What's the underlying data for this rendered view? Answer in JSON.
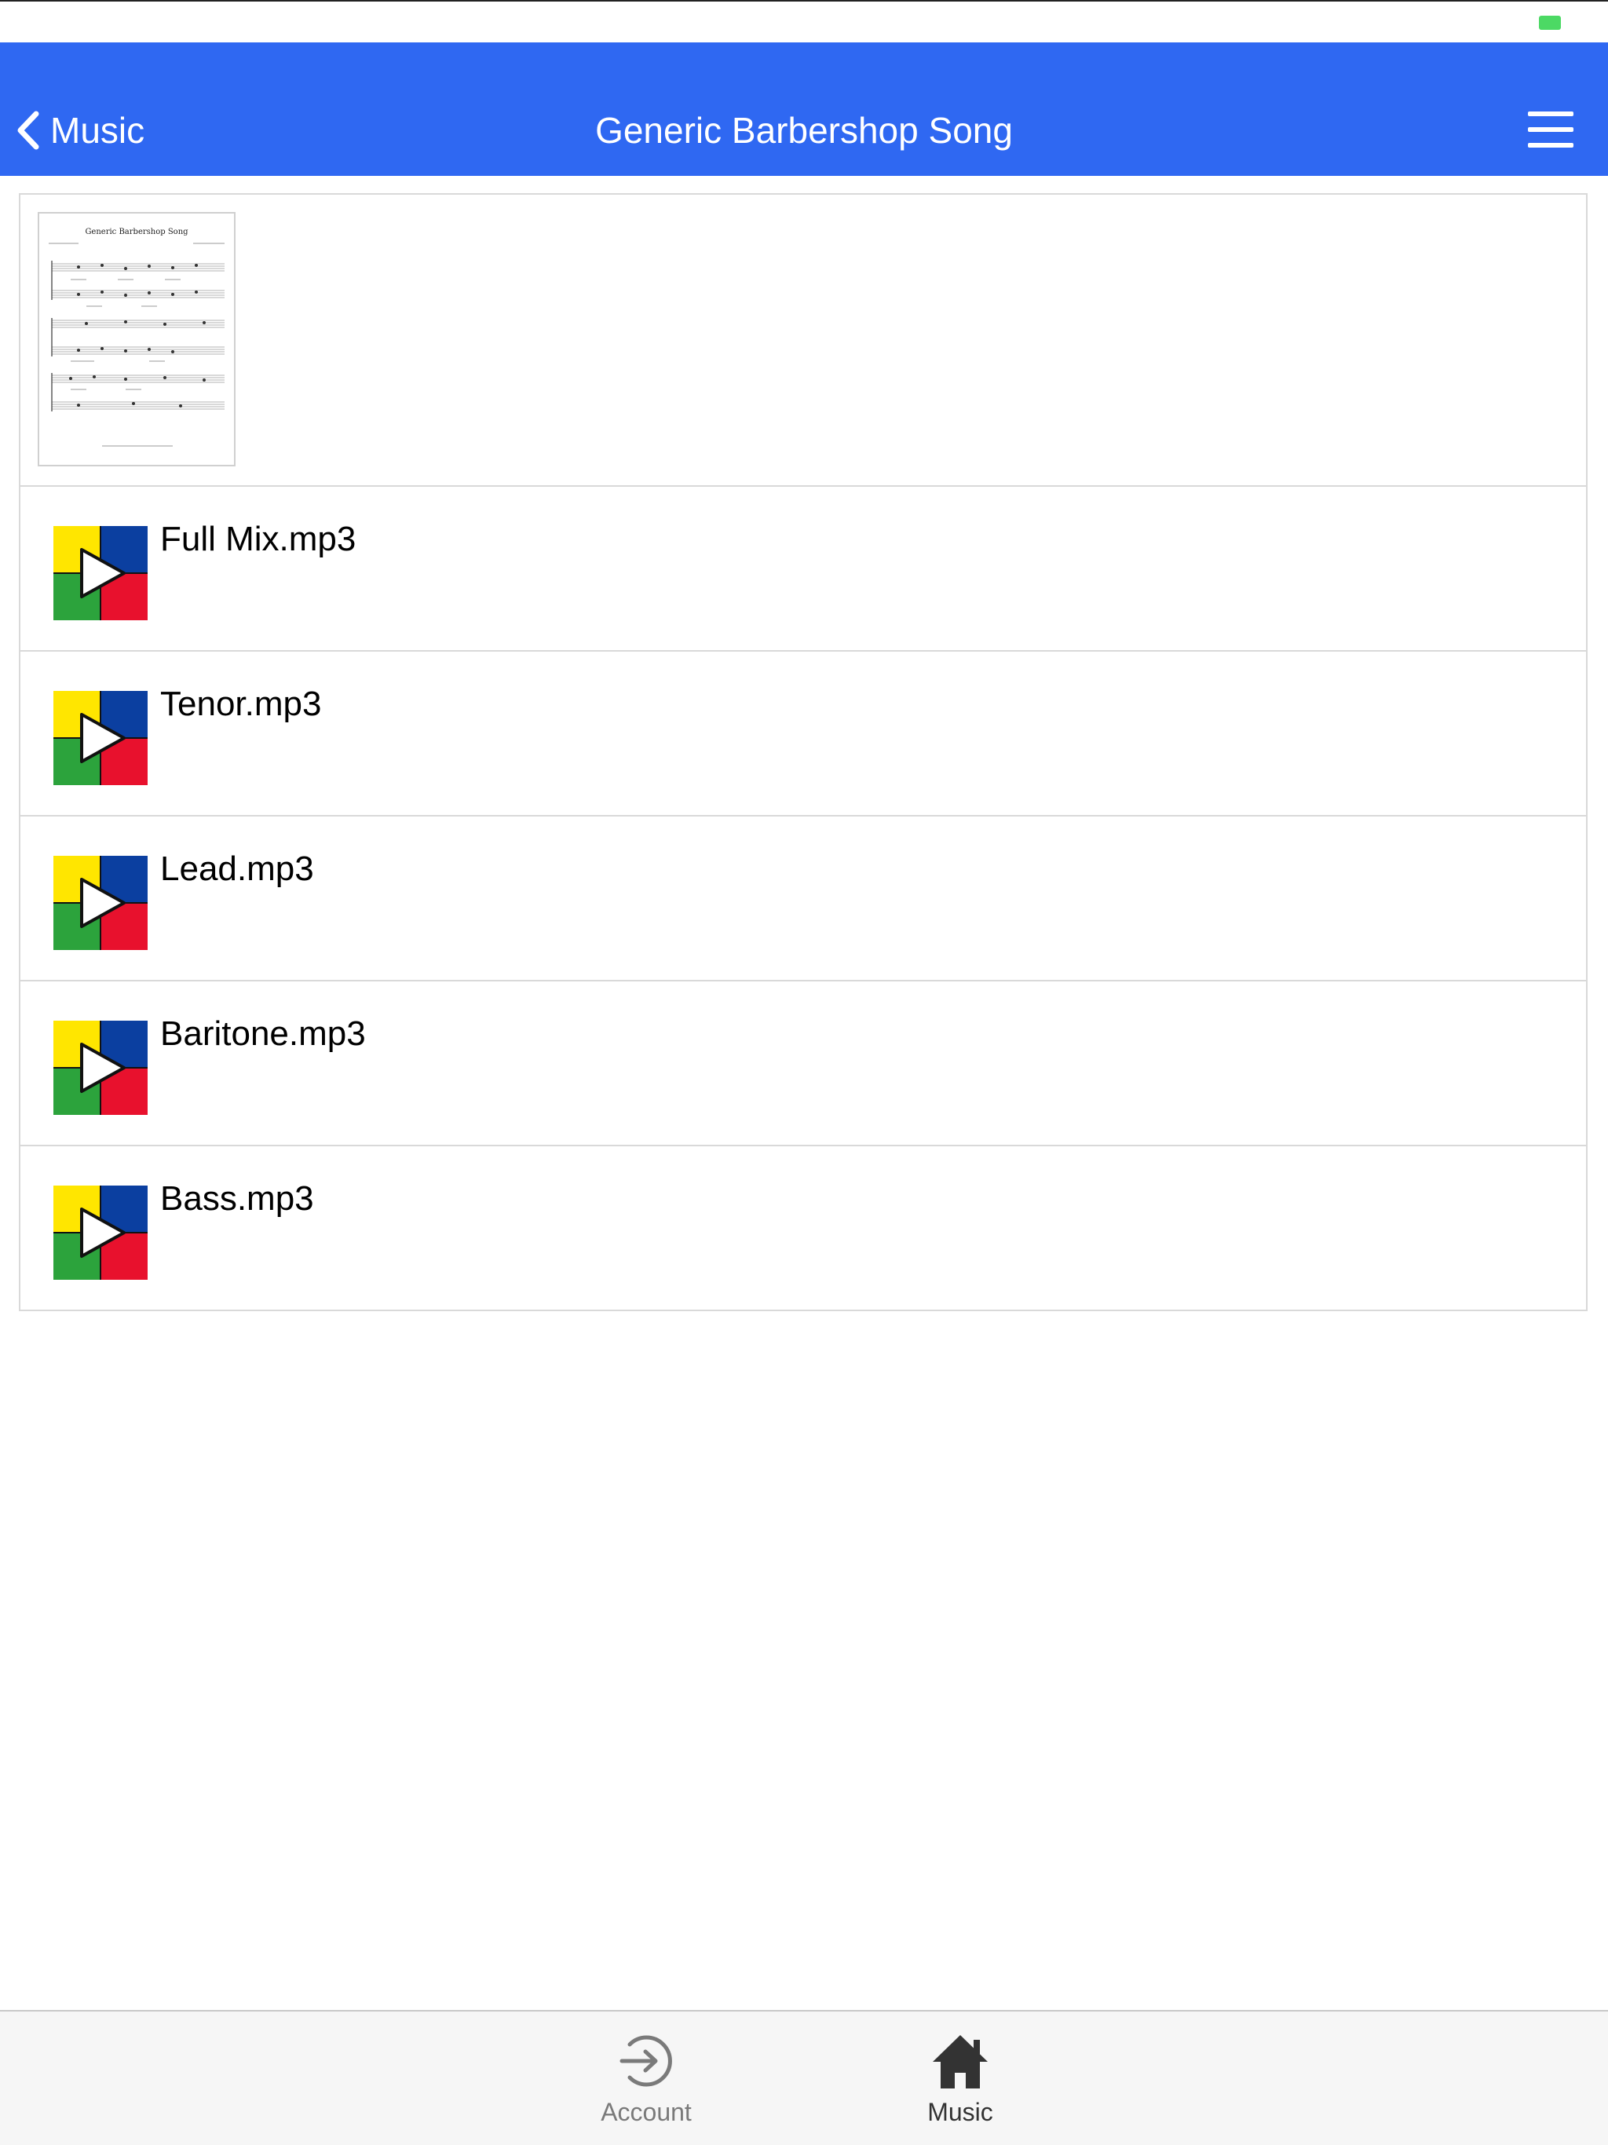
{
  "nav": {
    "back_label": "Music",
    "title": "Generic Barbershop Song"
  },
  "sheet": {
    "icon": "sheet-music-thumbnail",
    "thumbnail_title": "Generic Barbershop Song"
  },
  "tracks": [
    {
      "name": "Full Mix.mp3",
      "icon": "audio-play-icon"
    },
    {
      "name": "Tenor.mp3",
      "icon": "audio-play-icon"
    },
    {
      "name": "Lead.mp3",
      "icon": "audio-play-icon"
    },
    {
      "name": "Baritone.mp3",
      "icon": "audio-play-icon"
    },
    {
      "name": "Bass.mp3",
      "icon": "audio-play-icon"
    }
  ],
  "tabs": [
    {
      "label": "Account",
      "icon": "sign-in-icon",
      "active": false
    },
    {
      "label": "Music",
      "icon": "home-icon",
      "active": true
    }
  ],
  "colors": {
    "nav_background": "#2f68f2",
    "tab_active": "#333333",
    "tab_inactive": "#7a7a7a",
    "icon_yellow": "#ffe600",
    "icon_blue": "#0b3fa0",
    "icon_green": "#2ca33c",
    "icon_red": "#e8112d",
    "battery": "#4cd964"
  }
}
